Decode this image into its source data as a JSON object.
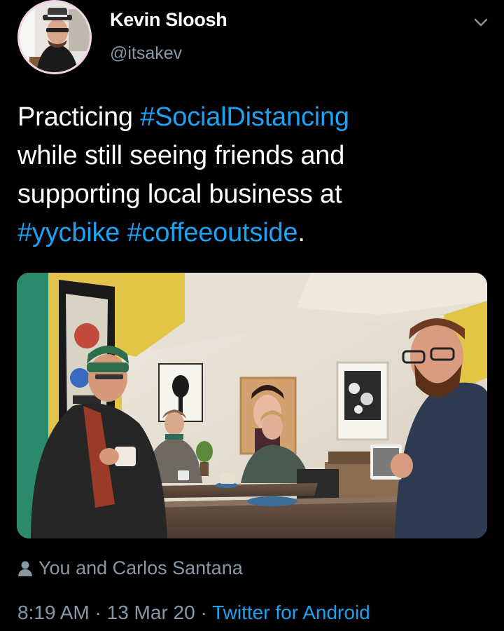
{
  "tweet": {
    "author_name": "Kevin Sloosh",
    "handle": "@itsakev",
    "text_lines": [
      {
        "segments": [
          {
            "text": "Practicing ",
            "tag": false
          },
          {
            "text": "#SocialDistancing",
            "tag": true
          }
        ]
      },
      {
        "segments": [
          {
            "text": "while still seeing friends and",
            "tag": false
          }
        ]
      },
      {
        "segments": [
          {
            "text": "supporting local business at",
            "tag": false
          }
        ]
      },
      {
        "segments": [
          {
            "text": "#yycbike",
            "tag": true
          },
          {
            "text": " ",
            "tag": false
          },
          {
            "text": "#coffeeoutside",
            "tag": true
          },
          {
            "text": ".",
            "tag": false
          }
        ]
      }
    ],
    "tagged_people": "You and Carlos Santana",
    "time": "8:19 AM",
    "date": "13 Mar 20",
    "source": "Twitter for Android",
    "separator": " · "
  },
  "icons": {
    "menu": "chevron-down-icon",
    "tagged": "person-icon"
  },
  "colors": {
    "background": "#000000",
    "text": "#ffffff",
    "secondary": "#8899a6",
    "link": "#1da1f2",
    "avatar_ring": "#f3d3e1"
  }
}
